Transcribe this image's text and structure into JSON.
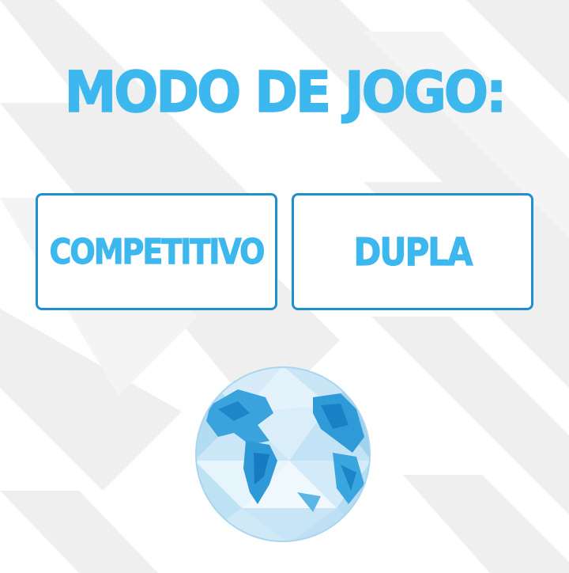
{
  "screen": {
    "title": "MODO DE JOGO:"
  },
  "modes": {
    "competitivo_label": "COMPETITIVO",
    "dupla_label": "DUPLA"
  },
  "globe": {
    "icon": "low-poly-globe-icon"
  },
  "colors": {
    "accent": "#3db8ef",
    "border": "#1f8fcf",
    "background_chevron": "#ededed"
  }
}
